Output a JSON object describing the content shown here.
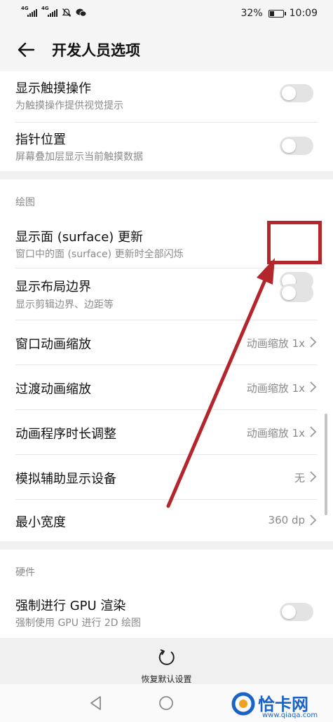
{
  "status_bar": {
    "signal_tag_1": "4G",
    "signal_tag_2": "4G",
    "battery_percent": "32%",
    "battery_level": 0.32,
    "time": "10:09",
    "icons": [
      "signal-icon",
      "signal-icon",
      "mute-icon",
      "wechat-icon",
      "battery-icon"
    ]
  },
  "header": {
    "title": "开发人员选项"
  },
  "top_card": {
    "items": [
      {
        "title": "显示触摸操作",
        "subtitle": "为触摸操作提供视觉提示",
        "toggle_on": false
      },
      {
        "title": "指针位置",
        "subtitle": "屏幕叠加层显示当前触摸数据",
        "toggle_on": false
      }
    ]
  },
  "drawing_section": {
    "label": "绘图",
    "toggle_items": [
      {
        "title": "显示面 (surface) 更新",
        "subtitle": "窗口中的面 (surface) 更新时全部闪烁",
        "toggle_on": false
      },
      {
        "title": "显示布局边界",
        "subtitle": "显示剪辑边界、边距等",
        "toggle_on": false
      }
    ],
    "value_items": [
      {
        "title": "窗口动画缩放",
        "value": "动画缩放 1x"
      },
      {
        "title": "过渡动画缩放",
        "value": "动画缩放 1x"
      },
      {
        "title": "动画程序时长调整",
        "value": "动画缩放 1x"
      },
      {
        "title": "模拟辅助显示设备",
        "value": "无"
      },
      {
        "title": "最小宽度",
        "value": "360 dp"
      }
    ]
  },
  "hardware_section": {
    "label": "硬件",
    "items": [
      {
        "title": "强制进行 GPU 渲染",
        "subtitle": "强制使用 GPU 进行 2D 绘图",
        "toggle_on": false
      }
    ]
  },
  "bottom_action": {
    "label": "恢复默认设置",
    "icon": "reset-icon"
  },
  "colors": {
    "annotation": "#b3262c",
    "watermark": "#1a63c6",
    "toggle_off": "#e3e3e3"
  },
  "watermark": {
    "text": "恰卡网",
    "url": "www.qiaqa.com"
  }
}
